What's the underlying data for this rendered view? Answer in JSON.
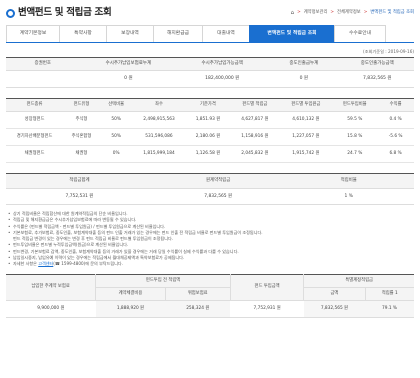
{
  "header": {
    "title": "변액펀드 및 적립금 조회",
    "breadcrumb": [
      "계약정보관리",
      "전체계약정보",
      "변액펀드 및 적립금 조회"
    ]
  },
  "tabs": [
    "계약기본정보",
    "특약사항",
    "보장내역",
    "해지환급금",
    "대출내역",
    "변액펀드 및 적립금 조회",
    "수수료안내"
  ],
  "active_tab": 5,
  "std_date": "(조회기준일 : 2019-09-16)",
  "summary": {
    "headers": [
      "증권번호",
      "수시추가납입보험료누계",
      "수시추가납입가능금액",
      "중도인출금누계",
      "중도인출가능금액"
    ],
    "values": [
      "",
      "0 원",
      "182,400,000 원",
      "0 원",
      "7,832,565 원"
    ]
  },
  "funds": {
    "headers": [
      "펀드종류",
      "펀드유형",
      "선택비율",
      "좌수",
      "기준가격",
      "펀드별 적립금",
      "펀드별 투입원금",
      "펀드투입비율",
      "수익률"
    ],
    "rows": [
      [
        "성장형펀드",
        "주식형",
        "50%",
        "2,498,915,563",
        "1,851.93 원",
        "4,627,817 원",
        "4,610,132 원",
        "59.5 %",
        "0.4 %"
      ],
      [
        "경기자산배분형펀드",
        "주식혼합형",
        "50%",
        "531,596,086",
        "2,180.06 원",
        "1,158,916 원",
        "1,227,057 원",
        "15.8 %",
        "-5.6 %"
      ],
      [
        "채권형펀드",
        "채권형",
        "0%",
        "1,815,999,184",
        "1,126.58 원",
        "2,045,832 원",
        "1,915,742 원",
        "24.7 %",
        "6.8 %"
      ]
    ]
  },
  "totals": {
    "headers": [
      "적립금합계",
      "원계약적립금",
      "적립비율"
    ],
    "values": [
      "7,752,531 원",
      "7,832,565 원",
      "1 %"
    ]
  },
  "notes": [
    "상기 적립비율은 적립합산에 대한 원계약적립금의 단순 비율입니다.",
    "적립금 및 해지환급금은 수시추가납입보험료에 따라 변동될 수 있습니다.",
    "수익률은 (펀드별 적립금액 - 펀드별 투입원금) / 펀드별 투입원금으로 계산된 비율입니다.",
    "기본보험료, 추가보험료, 중도인출, 보험계약대출 등의 펀드 인출 거래가 있는 경우에는 펀드 인출 전 적립금 비율로 펀드별 투입원금이 조정됩니다.",
    "펀드 적립금 변경이 있는 경우에는 변경 후 펀드 적립금 비율로 펀드별 투입원금이 조정됩니다.",
    "펀드투입비율은 펀드별 누적투입금액(원금)으로 계산된 비율입니다.",
    "펀드변경, 기본보험료 감액, 중도인출, 보험계약대출 등의 거래가 있을 경우에는 거래 당일 수익률이 실제 수익률과 다를 수 있습니다.",
    "납입일시중지, 납입유예 이력이 있는 경우에는 적립금에서 월대체공제액과 특약보험료가 공제됩니다.",
    "자세한 사항은 고객센터(☎ 1599-4800)에 문의 부탁드립니다."
  ],
  "note_link_text": "고객센터",
  "bottom": {
    "group_headers": [
      "납입한 주계약 보험료",
      "펀드투입 전 적립액",
      "펀드 투입금액",
      "특별계정적립금"
    ],
    "sub_headers": [
      "계약체결비용",
      "위험보험료",
      "금액",
      "적립률 1"
    ],
    "values": [
      "9,900,000 원",
      "1,888,920 원",
      "258,324 원",
      "7,752,931 원",
      "7,832,565 원",
      "79.1 %"
    ]
  }
}
